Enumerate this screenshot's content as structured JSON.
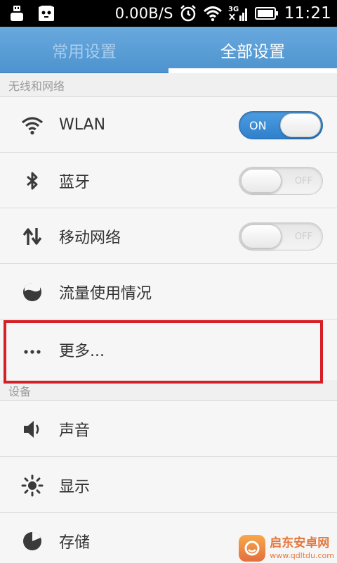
{
  "status_bar": {
    "network_speed": "0.00B/S",
    "network_type": "3G",
    "time": "11:21"
  },
  "tabs": [
    {
      "label": "常用设置",
      "active": false
    },
    {
      "label": "全部设置",
      "active": true
    }
  ],
  "sections": {
    "wireless": {
      "title": "无线和网络"
    },
    "device": {
      "title": "设备"
    }
  },
  "rows": {
    "wlan": {
      "label": "WLAN",
      "icon": "wifi-icon",
      "switch": {
        "state": "ON"
      }
    },
    "bluetooth": {
      "label": "蓝牙",
      "icon": "bluetooth-icon",
      "switch": {
        "state": "OFF"
      }
    },
    "mobile_network": {
      "label": "移动网络",
      "icon": "mobile-data-icon",
      "switch": {
        "state": "OFF"
      }
    },
    "data_usage": {
      "label": "流量使用情况",
      "icon": "data-usage-icon"
    },
    "more": {
      "label": "更多...",
      "icon": "more-icon"
    },
    "sound": {
      "label": "声音",
      "icon": "speaker-icon"
    },
    "display": {
      "label": "显示",
      "icon": "brightness-icon"
    },
    "storage": {
      "label": "存储",
      "icon": "storage-pie-icon"
    }
  },
  "watermark": {
    "title": "启东安卓网",
    "url": "www.qdltdu.com"
  },
  "colors": {
    "accent": "#4e93cf",
    "highlight": "#d71f27",
    "switch_on": "#2f80cc"
  }
}
